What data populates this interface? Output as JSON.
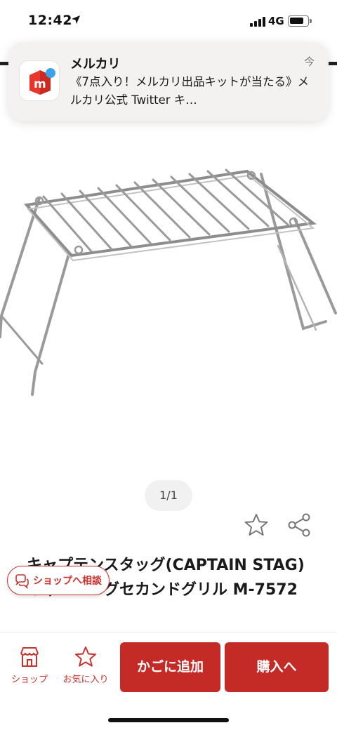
{
  "status_bar": {
    "time": "12:42",
    "network": "4G",
    "location_icon": "location-arrow-icon",
    "signal_icon": "signal-bars-icon",
    "battery_icon": "battery-icon",
    "battery_level": 0.75
  },
  "notification": {
    "app_name": "メルカリ",
    "time": "今",
    "body": "《7点入り！メルカリ出品キットが当たる》メルカリ公式 Twitter キ…",
    "icon": "mercari-app-icon"
  },
  "gallery": {
    "page_indicator": "1/1",
    "image": "grill-rack-image"
  },
  "actions": {
    "favorite_icon": "star-outline-icon",
    "share_icon": "share-icon"
  },
  "product": {
    "title": "キャプテンスタッグ(CAPTAIN STAG) キャンピングセカンドグリル M-7572"
  },
  "chat": {
    "label": "ショップへ相談",
    "icon": "chat-bubble-icon"
  },
  "bottom_bar": {
    "shop_label": "ショップ",
    "favorite_label": "お気に入り",
    "cart_label": "かごに追加",
    "buy_label": "購入へ"
  },
  "colors": {
    "accent": "#c42b27",
    "accent_text": "#c8332e"
  }
}
